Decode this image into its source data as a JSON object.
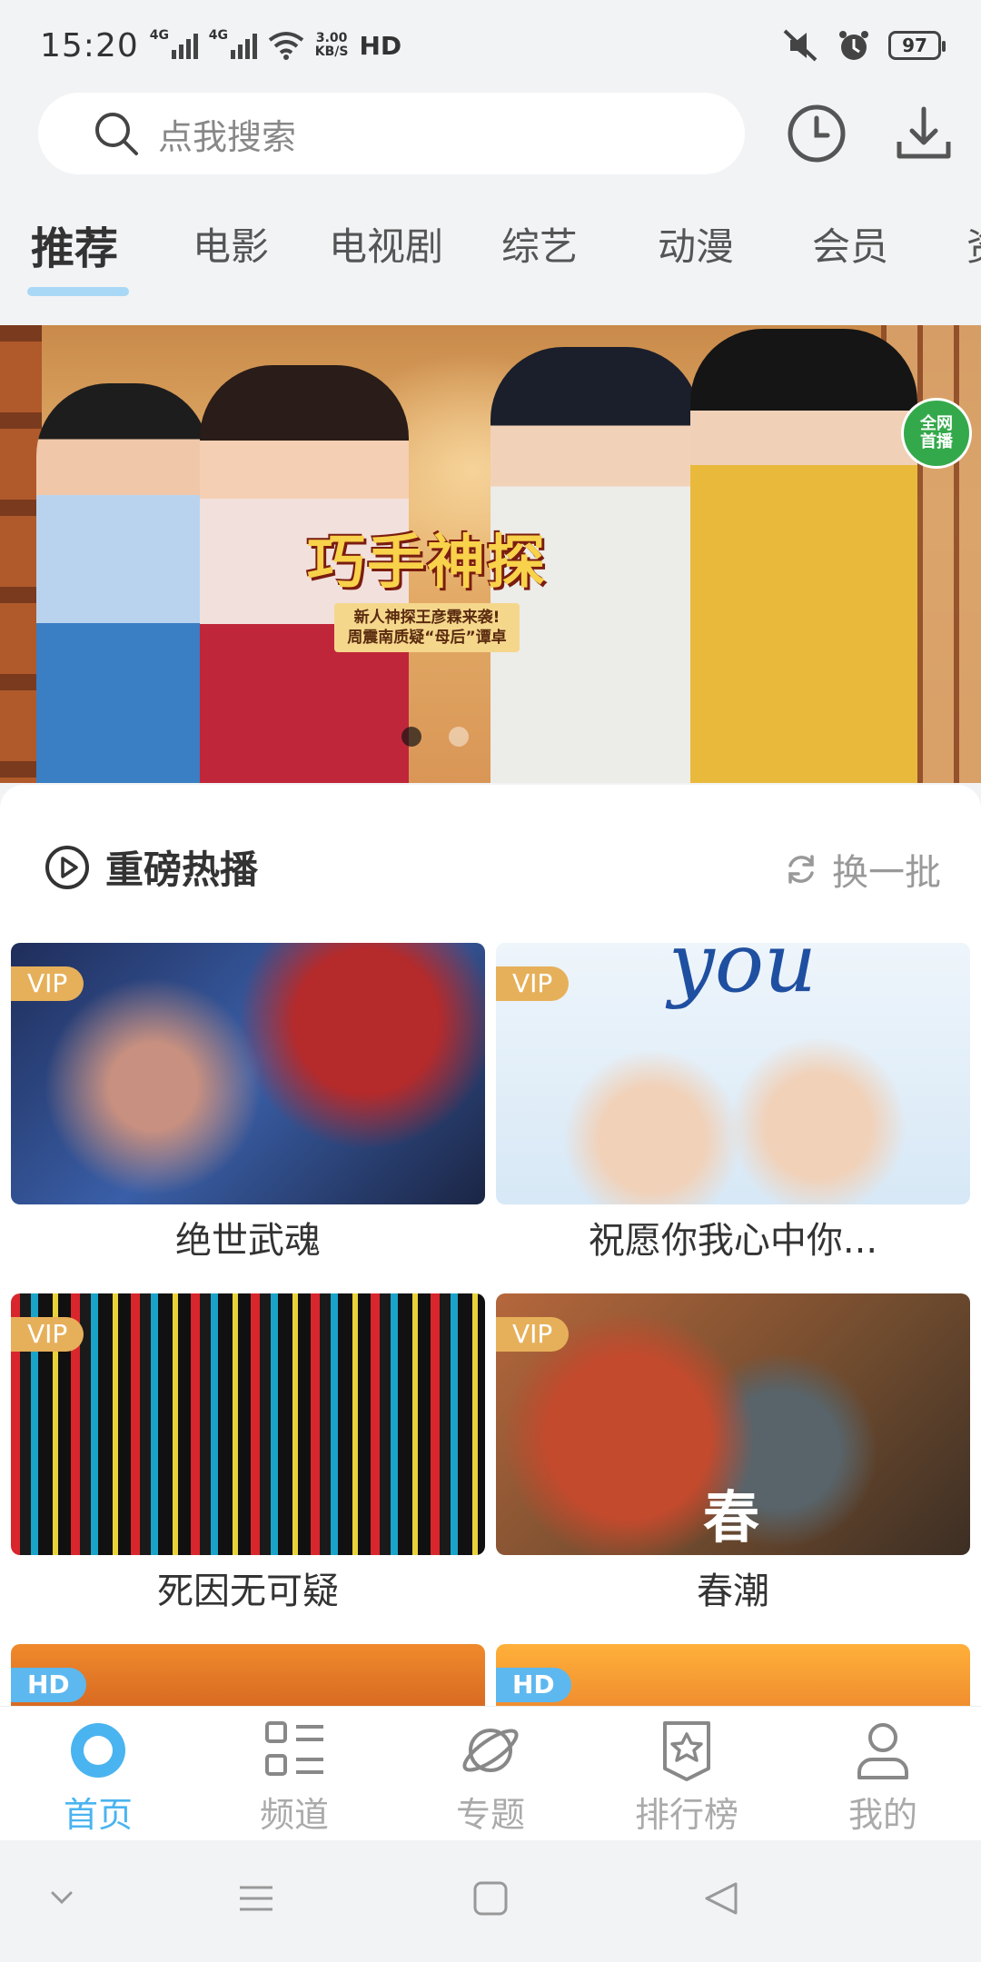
{
  "status": {
    "time": "15:20",
    "net1": "4G",
    "net2": "4G",
    "speed_value": "3.00",
    "speed_unit": "KB/S",
    "hd": "HD",
    "battery": "97"
  },
  "search": {
    "placeholder": "点我搜索"
  },
  "tabs": [
    {
      "label": "推荐"
    },
    {
      "label": "电影"
    },
    {
      "label": "电视剧"
    },
    {
      "label": "综艺"
    },
    {
      "label": "动漫"
    },
    {
      "label": "会员"
    },
    {
      "label": "资"
    }
  ],
  "banner": {
    "logo": "巧手神探",
    "caption_line1": "新人神探王彦霖来袭!",
    "caption_line2": "周震南质疑“母后”谭卓",
    "badge_line1": "全网",
    "badge_line2": "首播",
    "slide_count": 2,
    "active_slide": 0
  },
  "section": {
    "title": "重磅热播",
    "refresh_label": "换一批"
  },
  "cards": [
    {
      "title": "绝世武魂",
      "badge": "VIP"
    },
    {
      "title": "祝愿你我心中你...",
      "badge": "VIP",
      "overlay": "you"
    },
    {
      "title": "死因无可疑",
      "badge": "VIP"
    },
    {
      "title": "春潮",
      "badge": "VIP",
      "overlay": "春"
    },
    {
      "title": "",
      "badge": "HD"
    },
    {
      "title": "",
      "badge": "HD"
    }
  ],
  "bottom_nav": [
    {
      "label": "首页",
      "icon": "home-icon"
    },
    {
      "label": "频道",
      "icon": "grid-icon"
    },
    {
      "label": "专题",
      "icon": "planet-icon"
    },
    {
      "label": "排行榜",
      "icon": "ranking-icon"
    },
    {
      "label": "我的",
      "icon": "profile-icon"
    }
  ],
  "colors": {
    "accent": "#4ab4f0",
    "vip_badge": "#e6b05a",
    "hd_badge": "#5db8ef"
  }
}
